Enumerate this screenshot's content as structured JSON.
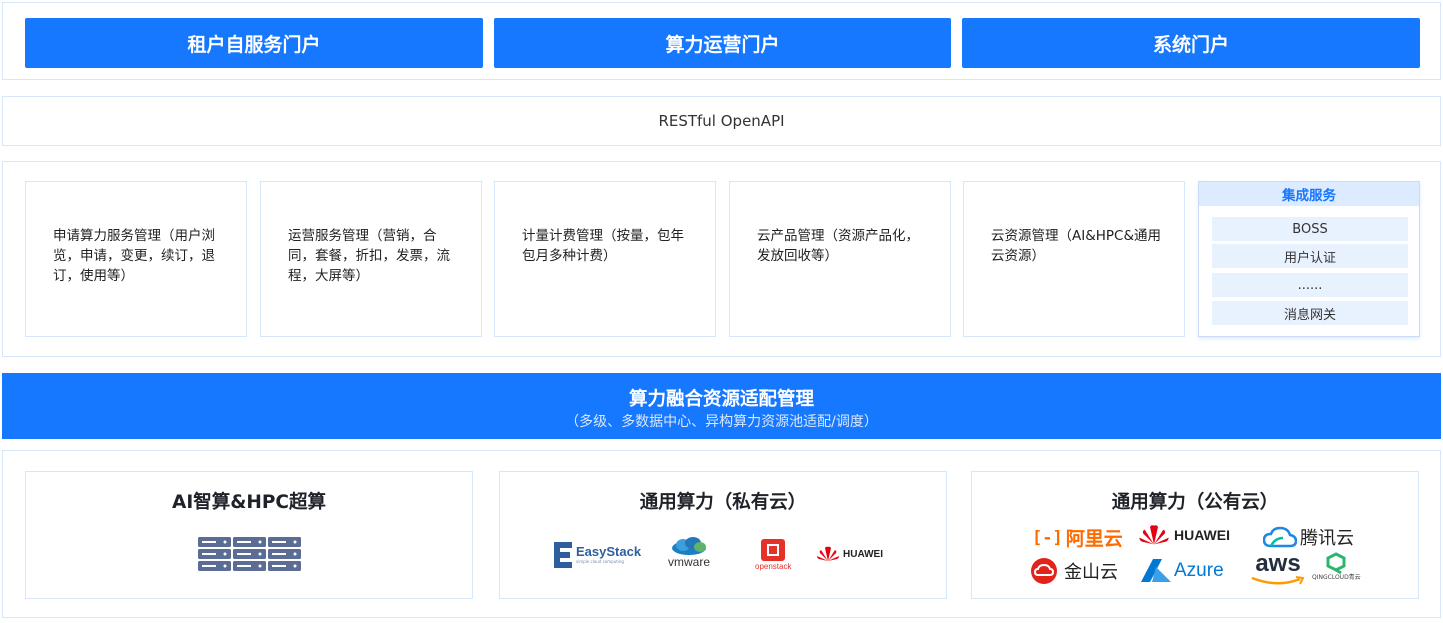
{
  "portals": [
    {
      "label": "租户自服务门户"
    },
    {
      "label": "算力运营门户"
    },
    {
      "label": "系统门户"
    }
  ],
  "api": {
    "label": "RESTful OpenAPI"
  },
  "services": [
    {
      "label": "申请算力服务管理（用户浏览，申请，变更，续订，退订，使用等）"
    },
    {
      "label": "运营服务管理（营销，合同，套餐，折扣，发票，流程，大屏等）"
    },
    {
      "label": "计量计费管理（按量，包年包月多种计费）"
    },
    {
      "label": "云产品管理（资源产品化，发放回收等）"
    },
    {
      "label": "云资源管理（AI&HPC&通用云资源）"
    }
  ],
  "integration": {
    "title": "集成服务",
    "items": [
      {
        "label": "BOSS"
      },
      {
        "label": "用户认证"
      },
      {
        "label": "......"
      },
      {
        "label": "消息网关"
      }
    ]
  },
  "fusion": {
    "title": "算力融合资源适配管理",
    "subtitle": "（多级、多数据中心、异构算力资源池适配/调度）"
  },
  "resources": {
    "ai_hpc": {
      "title": "AI智算&HPC超算"
    },
    "private": {
      "title": "通用算力（私有云）",
      "logos": {
        "easystack": "EasyStack",
        "easystack_tag": "simple cloud computing",
        "vmware": "vmware",
        "openstack": "openstack",
        "huawei": "HUAWEI"
      }
    },
    "public": {
      "title": "通用算力（公有云）",
      "logos": {
        "aliyun": "阿里云",
        "huawei": "HUAWEI",
        "tencent": "腾讯云",
        "kingsoft": "金山云",
        "azure": "Azure",
        "aws": "aws",
        "qingcloud": "QINGCLOUD青云"
      }
    }
  },
  "colors": {
    "primary": "#1677ff",
    "border": "#d6e6fb",
    "light": "#e8f1fe"
  }
}
